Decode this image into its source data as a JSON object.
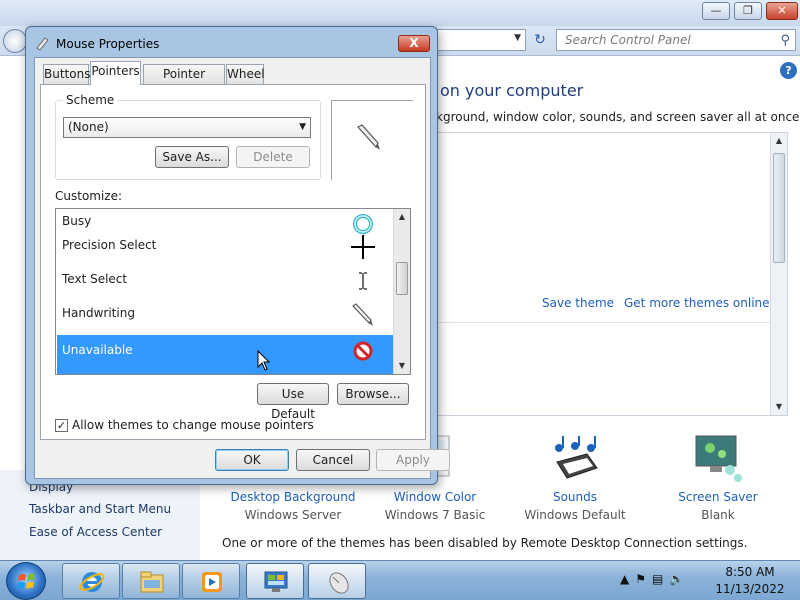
{
  "control_panel": {
    "search_placeholder": "Search Control Panel",
    "heading": "on your computer",
    "subtext": "kground, window color, sounds, and screen saver all at once.",
    "links": {
      "save_theme": "Save theme",
      "get_more_themes": "Get more themes online"
    },
    "items": [
      {
        "title": "Desktop Background",
        "subtitle": "Windows Server"
      },
      {
        "title": "Window Color",
        "subtitle": "Windows 7 Basic"
      },
      {
        "title": "Sounds",
        "subtitle": "Windows Default"
      },
      {
        "title": "Screen Saver",
        "subtitle": "Blank"
      }
    ],
    "disabled_note": "One or more of the themes has been disabled by Remote Desktop Connection settings.",
    "see_also": [
      "Display",
      "Taskbar and Start Menu",
      "Ease of Access Center"
    ]
  },
  "dialog": {
    "title": "Mouse Properties",
    "close_label": "X",
    "tabs": [
      "Buttons",
      "Pointers",
      "Pointer Options",
      "Wheel"
    ],
    "active_tab": "Pointers",
    "scheme": {
      "label": "Scheme",
      "value": "(None)",
      "save_as": "Save As...",
      "delete": "Delete"
    },
    "customize_label": "Customize:",
    "cursors": [
      {
        "name": "Busy",
        "icon": "busy-ring-icon"
      },
      {
        "name": "Precision Select",
        "icon": "crosshair-icon"
      },
      {
        "name": "Text Select",
        "icon": "ibeam-icon"
      },
      {
        "name": "Handwriting",
        "icon": "pen-icon"
      },
      {
        "name": "Unavailable",
        "icon": "unavailable-icon",
        "selected": true
      }
    ],
    "use_default": "Use Default",
    "browse": "Browse...",
    "allow_themes": {
      "label": "Allow themes to change mouse pointers",
      "checked": true
    },
    "ok": "OK",
    "cancel": "Cancel",
    "apply": "Apply"
  },
  "taskbar": {
    "time": "8:50 AM",
    "date": "11/13/2022",
    "apps": [
      "internet-explorer-icon",
      "windows-explorer-icon",
      "media-player-icon",
      "control-panel-icon",
      "mouse-icon"
    ]
  }
}
